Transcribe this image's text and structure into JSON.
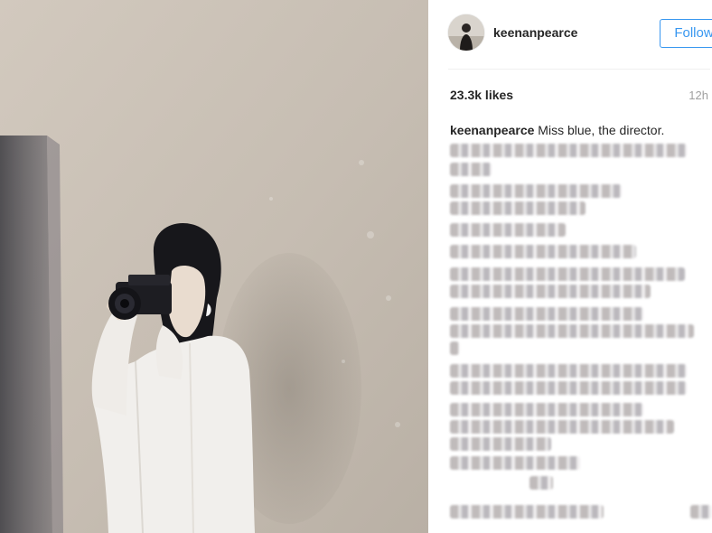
{
  "post": {
    "username": "keenanpearce",
    "follow_label": "Follow",
    "likes": "23.3k likes",
    "age": "12h",
    "caption_user": "keenanpearce",
    "caption_text": "Miss blue, the director."
  },
  "colors": {
    "accent": "#3897f0",
    "text": "#262626",
    "muted": "#a0a0a0",
    "divider": "#efefef",
    "wall": "#c8bfb4"
  },
  "icons": {
    "avatar": "profile-photo"
  }
}
